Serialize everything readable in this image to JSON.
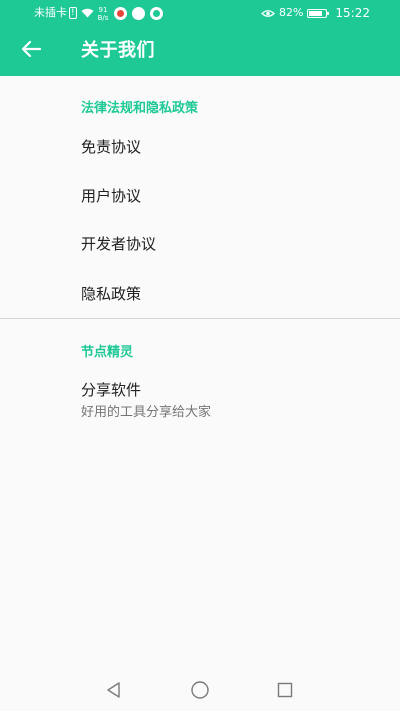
{
  "status_bar": {
    "carrier": "未插卡",
    "network_speed_value": "91",
    "network_speed_unit": "B/s",
    "battery_percent": "82%",
    "battery_level": 0.82,
    "time": "15:22"
  },
  "app_bar": {
    "title": "关于我们"
  },
  "sections": [
    {
      "header": "法律法规和隐私政策",
      "items": [
        {
          "label": "免责协议"
        },
        {
          "label": "用户协议"
        },
        {
          "label": "开发者协议"
        },
        {
          "label": "隐私政策"
        }
      ]
    },
    {
      "header": "节点精灵",
      "items": [
        {
          "label": "分享软件",
          "subtitle": "好用的工具分享给大家"
        }
      ]
    }
  ],
  "colors": {
    "accent": "#1ec996",
    "background": "#fafafa",
    "text_primary": "#212121",
    "text_secondary": "#757575"
  },
  "icons": {
    "back": "arrow-left-icon",
    "nav_back": "triangle-back-icon",
    "nav_home": "circle-home-icon",
    "nav_recent": "square-recent-icon"
  }
}
